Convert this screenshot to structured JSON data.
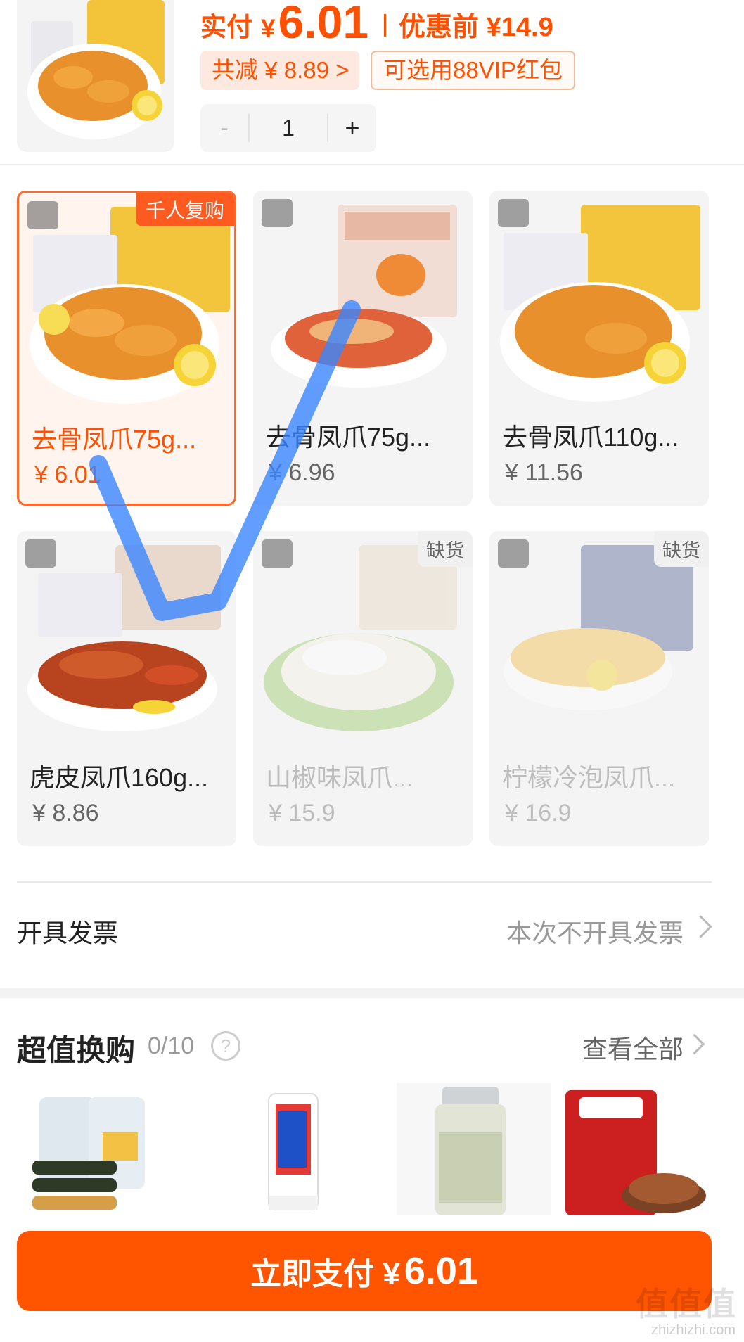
{
  "summary": {
    "paid_label": "实付",
    "yen": "¥",
    "paid_amount": "6.01",
    "before_discount": "优惠前 ¥14.9",
    "discount_chip": "共减 ¥ 8.89 >",
    "vip_chip": "可选用88VIP红包",
    "stepper": {
      "minus": "-",
      "quantity": "1",
      "plus": "+"
    }
  },
  "skus": [
    {
      "name": "去骨凤爪75g...",
      "price": "¥ 6.01",
      "tag": "千人复购",
      "selected": true,
      "out_of_stock": false
    },
    {
      "name": "去骨凤爪75g...",
      "price": "¥ 6.96",
      "selected": false,
      "out_of_stock": false
    },
    {
      "name": "去骨凤爪110g...",
      "price": "¥ 11.56",
      "selected": false,
      "out_of_stock": false
    },
    {
      "name": "虎皮凤爪160g...",
      "price": "¥ 8.86",
      "selected": false,
      "out_of_stock": false
    },
    {
      "name": "山椒味凤爪...",
      "price": "¥ 15.9",
      "stock": "缺货",
      "selected": false,
      "out_of_stock": true
    },
    {
      "name": "柠檬冷泡凤爪...",
      "price": "¥ 16.9",
      "stock": "缺货",
      "selected": false,
      "out_of_stock": true
    }
  ],
  "invoice": {
    "label": "开具发票",
    "value": "本次不开具发票"
  },
  "exchange": {
    "title": "超值换购",
    "count": "0/10",
    "help": "?",
    "view_all": "查看全部"
  },
  "pay_button": {
    "label": "立即支付 ¥",
    "amount": "6.01"
  },
  "watermark": {
    "main": "值值值",
    "sub": "zhizhizhi.com"
  },
  "colors": {
    "accent": "#ff5000",
    "pay_button": "#ff5500",
    "selected_border": "#ff6a2b",
    "annotation_stroke": "#3a86ff"
  }
}
